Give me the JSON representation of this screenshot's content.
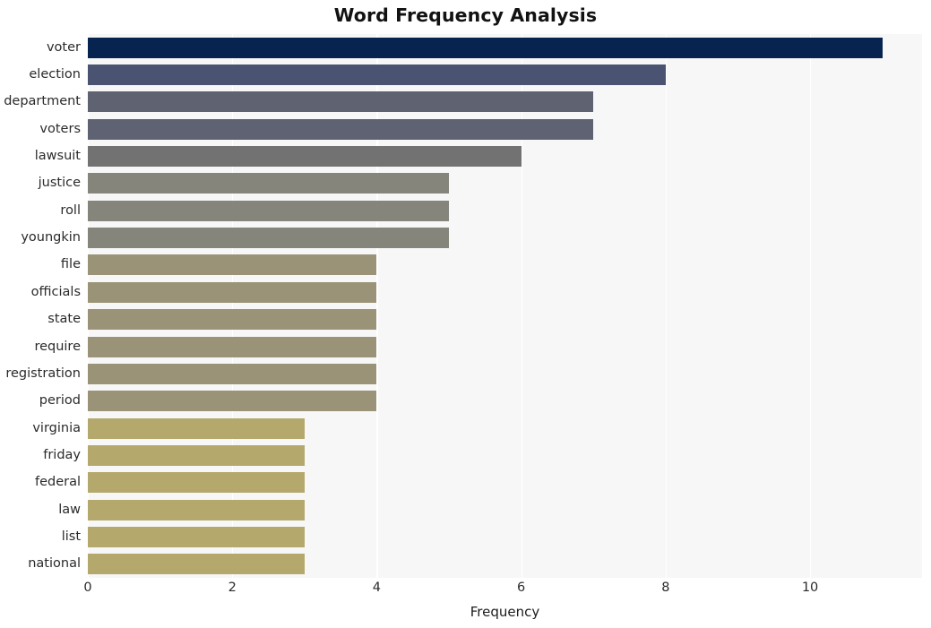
{
  "chart_data": {
    "type": "bar",
    "orientation": "horizontal",
    "title": "Word Frequency Analysis",
    "xlabel": "Frequency",
    "ylabel": "",
    "categories": [
      "voter",
      "election",
      "department",
      "voters",
      "lawsuit",
      "justice",
      "roll",
      "youngkin",
      "file",
      "officials",
      "state",
      "require",
      "registration",
      "period",
      "virginia",
      "friday",
      "federal",
      "law",
      "list",
      "national"
    ],
    "values": [
      11,
      8,
      7,
      7,
      6,
      5,
      5,
      5,
      4,
      4,
      4,
      4,
      4,
      4,
      3,
      3,
      3,
      3,
      3,
      3
    ],
    "bar_colors": [
      "#06244f",
      "#4a5472",
      "#5e6271",
      "#5f6272",
      "#727272",
      "#85857b",
      "#85857b",
      "#85857b",
      "#9a9377",
      "#9a9377",
      "#9a9377",
      "#9a9377",
      "#9a9377",
      "#9a9377",
      "#b5a86c",
      "#b5a86c",
      "#b5a86c",
      "#b5a86c",
      "#b5a86c",
      "#b5a86c"
    ],
    "xlim": [
      0,
      11.55
    ],
    "ylim_category_count": 20,
    "xticks": [
      0,
      2,
      4,
      6,
      8,
      10
    ],
    "xtick_labels": [
      "0",
      "2",
      "4",
      "6",
      "8",
      "10"
    ],
    "grid": {
      "vertical": true,
      "horizontal": false,
      "color": "#ffffff"
    },
    "plot_background": "#f7f7f7",
    "figure_background": "#ffffff",
    "legend": null
  }
}
